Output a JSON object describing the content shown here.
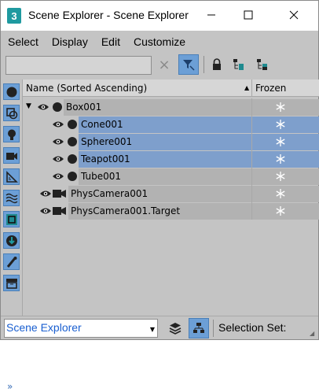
{
  "window": {
    "app_icon": "3",
    "title": "Scene Explorer - Scene Explorer"
  },
  "menu": [
    "Select",
    "Display",
    "Edit",
    "Customize"
  ],
  "toolbar": {
    "search_value": "",
    "clear_icon": "×"
  },
  "columns": {
    "name": "Name (Sorted Ascending)",
    "frozen": "Frozen"
  },
  "rows": [
    {
      "label": "Box001",
      "type": "geometry",
      "state": "hl"
    },
    {
      "label": "Cone001",
      "type": "geometry",
      "state": "sel"
    },
    {
      "label": "Sphere001",
      "type": "geometry",
      "state": "sel"
    },
    {
      "label": "Teapot001",
      "type": "geometry",
      "state": "sel"
    },
    {
      "label": "Tube001",
      "type": "geometry",
      "state": "hl"
    },
    {
      "label": "PhysCamera001",
      "type": "camera",
      "state": "hl"
    },
    {
      "label": "PhysCamera001.Target",
      "type": "camera",
      "state": "hl"
    }
  ],
  "left_expand": "»",
  "status": {
    "dropdown_value": "Scene Explorer",
    "selection_set_label": "Selection Set:"
  },
  "colors": {
    "accent": "#6c9fd6",
    "selected_row": "#7e9fcc",
    "background": "#c4c4c4"
  }
}
